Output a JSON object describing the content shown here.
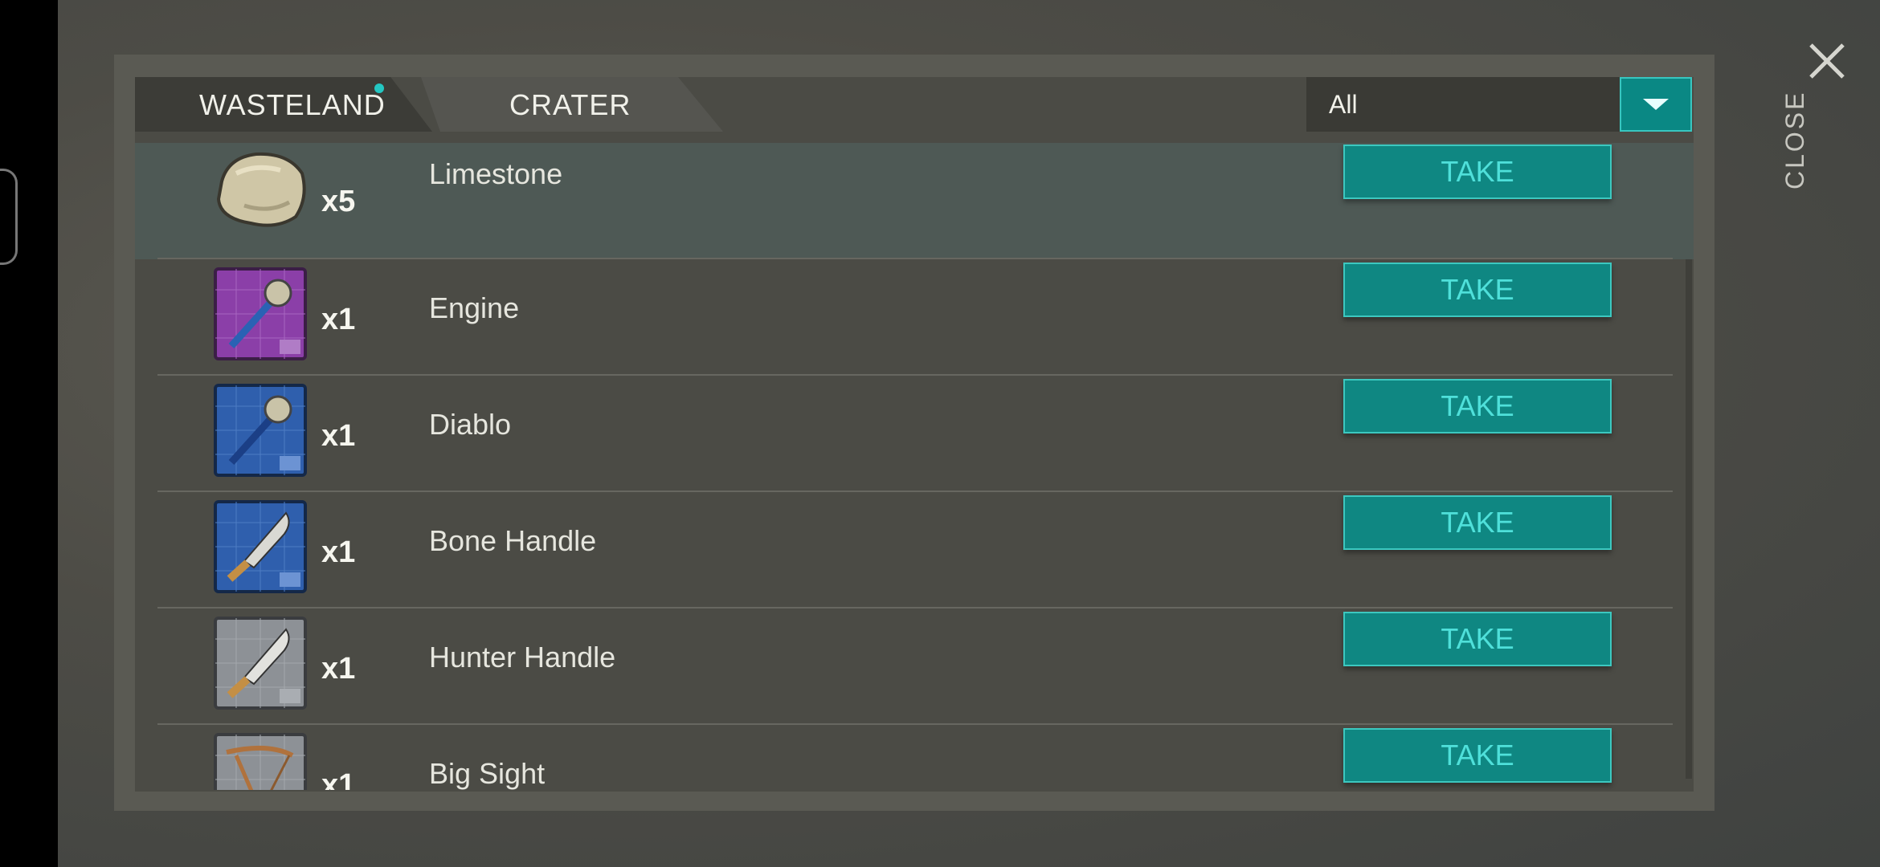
{
  "tabs": [
    {
      "label": "WASTELAND",
      "active": true,
      "has_notification": true
    },
    {
      "label": "CRATER",
      "active": false
    }
  ],
  "filter": {
    "selected": "All"
  },
  "close_label": "CLOSE",
  "take_label": "TAKE",
  "items": [
    {
      "name": "Limestone",
      "qty": "x5",
      "icon": "limestone-rock-icon"
    },
    {
      "name": "Engine",
      "qty": "x1",
      "icon": "purple-blueprint-mace-icon"
    },
    {
      "name": "Diablo",
      "qty": "x1",
      "icon": "blue-blueprint-mace-icon"
    },
    {
      "name": "Bone Handle",
      "qty": "x1",
      "icon": "blue-blueprint-machete-icon"
    },
    {
      "name": "Hunter Handle",
      "qty": "x1",
      "icon": "gray-blueprint-machete-icon"
    },
    {
      "name": "Big Sight",
      "qty": "x1",
      "icon": "gray-blueprint-crossbow-icon"
    }
  ],
  "colors": {
    "accent": "#0f8782",
    "accent_border": "#3cc8c0",
    "take_text": "#4fe0da",
    "notification": "#24c7c2"
  }
}
